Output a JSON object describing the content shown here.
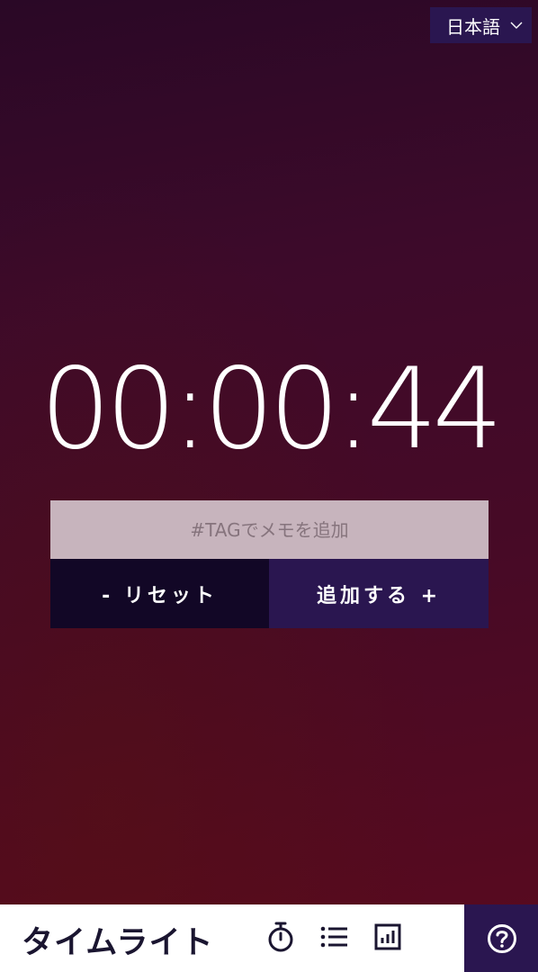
{
  "language": {
    "selected": "日本語",
    "icon": "chevron-down-icon"
  },
  "timer": {
    "display": "00:00:44"
  },
  "memo": {
    "placeholder": "#TAGでメモを追加",
    "value": ""
  },
  "actions": {
    "reset_label": "- リセット",
    "add_label": "追加する +"
  },
  "footer": {
    "brand": "タイムライト",
    "icons": [
      "stopwatch-icon",
      "list-icon",
      "chart-icon",
      "help-icon"
    ]
  },
  "colors": {
    "button_dark": "#120726",
    "button_accent": "#2a1650",
    "input_bg": "#c7b4bd",
    "footer_bg": "#ffffff"
  }
}
